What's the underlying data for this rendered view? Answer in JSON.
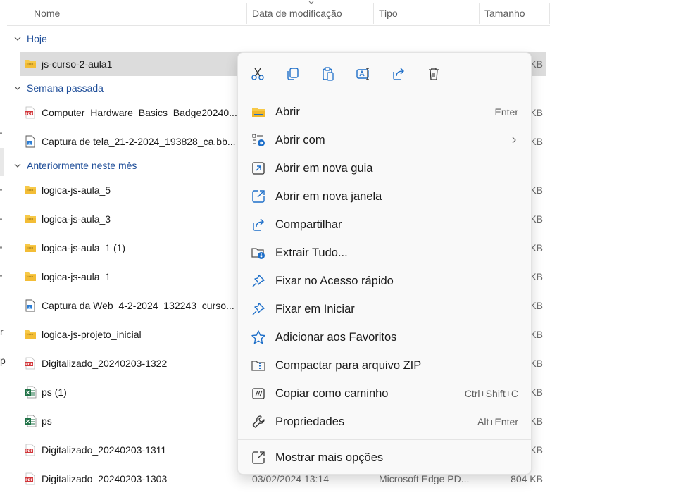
{
  "columns": {
    "name": "Nome",
    "date": "Data de modificação",
    "type": "Tipo",
    "size": "Tamanho"
  },
  "edge_letters": [
    "r",
    "p"
  ],
  "groups": {
    "today": "Hoje",
    "last_week": "Semana passada",
    "earlier_month": "Anteriormente neste mês"
  },
  "rows": [
    {
      "name": "js-curso-2-aula1",
      "icon": "folder-zip-icon",
      "size": "KB",
      "date": "",
      "type": ""
    },
    {
      "name": "Computer_Hardware_Basics_Badge20240...",
      "icon": "pdf-icon",
      "size": "KB",
      "date": "",
      "type": ""
    },
    {
      "name": "Captura de tela_21-2-2024_193828_ca.bb...",
      "icon": "image-file-icon",
      "size": "KB",
      "date": "",
      "type": ""
    },
    {
      "name": "logica-js-aula_5",
      "icon": "folder-zip-icon",
      "size": "KB",
      "date": "",
      "type": ""
    },
    {
      "name": "logica-js-aula_3",
      "icon": "folder-zip-icon",
      "size": "KB",
      "date": "",
      "type": ""
    },
    {
      "name": "logica-js-aula_1 (1)",
      "icon": "folder-zip-icon",
      "size": "KB",
      "date": "",
      "type": ""
    },
    {
      "name": "logica-js-aula_1",
      "icon": "folder-zip-icon",
      "size": "KB",
      "date": "",
      "type": ""
    },
    {
      "name": "Captura da Web_4-2-2024_132243_curso...",
      "icon": "image-file-icon",
      "size": "KB",
      "date": "",
      "type": ""
    },
    {
      "name": "logica-js-projeto_inicial",
      "icon": "folder-zip-icon",
      "size": "KB",
      "date": "",
      "type": ""
    },
    {
      "name": "Digitalizado_20240203-1322",
      "icon": "pdf-icon",
      "size": "KB",
      "date": "",
      "type": ""
    },
    {
      "name": "ps (1)",
      "icon": "excel-icon",
      "size": "KB",
      "date": "",
      "type": ""
    },
    {
      "name": "ps",
      "icon": "excel-icon",
      "size": "KB",
      "date": "",
      "type": ""
    },
    {
      "name": "Digitalizado_20240203-1311",
      "icon": "pdf-icon",
      "size": "KB",
      "date": "",
      "type": ""
    },
    {
      "name": "Digitalizado_20240203-1303",
      "icon": "pdf-icon",
      "size": "804 KB",
      "date": "03/02/2024 13:14",
      "type": "Microsoft Edge PD..."
    }
  ],
  "context_menu": {
    "toolbar": [
      "cut-icon",
      "copy-icon",
      "paste-icon",
      "rename-icon",
      "share-icon",
      "delete-icon"
    ],
    "items": [
      {
        "label": "Abrir",
        "shortcut": "Enter",
        "icon": "folder-open-icon"
      },
      {
        "label": "Abrir com",
        "shortcut": "",
        "icon": "open-with-icon",
        "submenu": true
      },
      {
        "label": "Abrir em nova guia",
        "shortcut": "",
        "icon": "new-tab-icon"
      },
      {
        "label": "Abrir em nova janela",
        "shortcut": "",
        "icon": "new-window-icon"
      },
      {
        "label": "Compartilhar",
        "shortcut": "",
        "icon": "share-icon"
      },
      {
        "label": "Extrair Tudo...",
        "shortcut": "",
        "icon": "extract-icon"
      },
      {
        "label": "Fixar no Acesso rápido",
        "shortcut": "",
        "icon": "pin-icon"
      },
      {
        "label": "Fixar em Iniciar",
        "shortcut": "",
        "icon": "pin-icon"
      },
      {
        "label": "Adicionar aos Favoritos",
        "shortcut": "",
        "icon": "star-icon"
      },
      {
        "label": "Compactar para arquivo ZIP",
        "shortcut": "",
        "icon": "zip-icon"
      },
      {
        "label": "Copiar como caminho",
        "shortcut": "Ctrl+Shift+C",
        "icon": "copy-path-icon"
      },
      {
        "label": "Propriedades",
        "shortcut": "Alt+Enter",
        "icon": "wrench-icon"
      }
    ],
    "more": {
      "label": "Mostrar mais opções",
      "icon": "more-options-icon"
    }
  },
  "colors": {
    "accent": "#1e6fc9",
    "group_text": "#1f4e99",
    "selected_row": "#dcdcdc",
    "menu_bg": "#f9f9f9",
    "folder": "#f7c948",
    "pdf": "#d13438",
    "excel": "#1e7145"
  }
}
